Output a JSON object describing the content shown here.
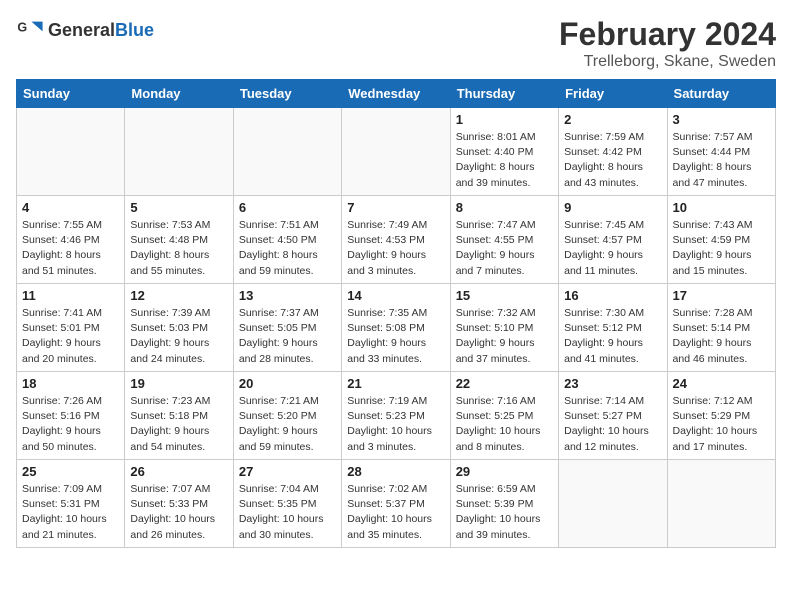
{
  "logo": {
    "general": "General",
    "blue": "Blue"
  },
  "header": {
    "month": "February 2024",
    "location": "Trelleborg, Skane, Sweden"
  },
  "weekdays": [
    "Sunday",
    "Monday",
    "Tuesday",
    "Wednesday",
    "Thursday",
    "Friday",
    "Saturday"
  ],
  "weeks": [
    [
      {
        "day": "",
        "sunrise": "",
        "sunset": "",
        "daylight": ""
      },
      {
        "day": "",
        "sunrise": "",
        "sunset": "",
        "daylight": ""
      },
      {
        "day": "",
        "sunrise": "",
        "sunset": "",
        "daylight": ""
      },
      {
        "day": "",
        "sunrise": "",
        "sunset": "",
        "daylight": ""
      },
      {
        "day": "1",
        "sunrise": "Sunrise: 8:01 AM",
        "sunset": "Sunset: 4:40 PM",
        "daylight": "Daylight: 8 hours and 39 minutes."
      },
      {
        "day": "2",
        "sunrise": "Sunrise: 7:59 AM",
        "sunset": "Sunset: 4:42 PM",
        "daylight": "Daylight: 8 hours and 43 minutes."
      },
      {
        "day": "3",
        "sunrise": "Sunrise: 7:57 AM",
        "sunset": "Sunset: 4:44 PM",
        "daylight": "Daylight: 8 hours and 47 minutes."
      }
    ],
    [
      {
        "day": "4",
        "sunrise": "Sunrise: 7:55 AM",
        "sunset": "Sunset: 4:46 PM",
        "daylight": "Daylight: 8 hours and 51 minutes."
      },
      {
        "day": "5",
        "sunrise": "Sunrise: 7:53 AM",
        "sunset": "Sunset: 4:48 PM",
        "daylight": "Daylight: 8 hours and 55 minutes."
      },
      {
        "day": "6",
        "sunrise": "Sunrise: 7:51 AM",
        "sunset": "Sunset: 4:50 PM",
        "daylight": "Daylight: 8 hours and 59 minutes."
      },
      {
        "day": "7",
        "sunrise": "Sunrise: 7:49 AM",
        "sunset": "Sunset: 4:53 PM",
        "daylight": "Daylight: 9 hours and 3 minutes."
      },
      {
        "day": "8",
        "sunrise": "Sunrise: 7:47 AM",
        "sunset": "Sunset: 4:55 PM",
        "daylight": "Daylight: 9 hours and 7 minutes."
      },
      {
        "day": "9",
        "sunrise": "Sunrise: 7:45 AM",
        "sunset": "Sunset: 4:57 PM",
        "daylight": "Daylight: 9 hours and 11 minutes."
      },
      {
        "day": "10",
        "sunrise": "Sunrise: 7:43 AM",
        "sunset": "Sunset: 4:59 PM",
        "daylight": "Daylight: 9 hours and 15 minutes."
      }
    ],
    [
      {
        "day": "11",
        "sunrise": "Sunrise: 7:41 AM",
        "sunset": "Sunset: 5:01 PM",
        "daylight": "Daylight: 9 hours and 20 minutes."
      },
      {
        "day": "12",
        "sunrise": "Sunrise: 7:39 AM",
        "sunset": "Sunset: 5:03 PM",
        "daylight": "Daylight: 9 hours and 24 minutes."
      },
      {
        "day": "13",
        "sunrise": "Sunrise: 7:37 AM",
        "sunset": "Sunset: 5:05 PM",
        "daylight": "Daylight: 9 hours and 28 minutes."
      },
      {
        "day": "14",
        "sunrise": "Sunrise: 7:35 AM",
        "sunset": "Sunset: 5:08 PM",
        "daylight": "Daylight: 9 hours and 33 minutes."
      },
      {
        "day": "15",
        "sunrise": "Sunrise: 7:32 AM",
        "sunset": "Sunset: 5:10 PM",
        "daylight": "Daylight: 9 hours and 37 minutes."
      },
      {
        "day": "16",
        "sunrise": "Sunrise: 7:30 AM",
        "sunset": "Sunset: 5:12 PM",
        "daylight": "Daylight: 9 hours and 41 minutes."
      },
      {
        "day": "17",
        "sunrise": "Sunrise: 7:28 AM",
        "sunset": "Sunset: 5:14 PM",
        "daylight": "Daylight: 9 hours and 46 minutes."
      }
    ],
    [
      {
        "day": "18",
        "sunrise": "Sunrise: 7:26 AM",
        "sunset": "Sunset: 5:16 PM",
        "daylight": "Daylight: 9 hours and 50 minutes."
      },
      {
        "day": "19",
        "sunrise": "Sunrise: 7:23 AM",
        "sunset": "Sunset: 5:18 PM",
        "daylight": "Daylight: 9 hours and 54 minutes."
      },
      {
        "day": "20",
        "sunrise": "Sunrise: 7:21 AM",
        "sunset": "Sunset: 5:20 PM",
        "daylight": "Daylight: 9 hours and 59 minutes."
      },
      {
        "day": "21",
        "sunrise": "Sunrise: 7:19 AM",
        "sunset": "Sunset: 5:23 PM",
        "daylight": "Daylight: 10 hours and 3 minutes."
      },
      {
        "day": "22",
        "sunrise": "Sunrise: 7:16 AM",
        "sunset": "Sunset: 5:25 PM",
        "daylight": "Daylight: 10 hours and 8 minutes."
      },
      {
        "day": "23",
        "sunrise": "Sunrise: 7:14 AM",
        "sunset": "Sunset: 5:27 PM",
        "daylight": "Daylight: 10 hours and 12 minutes."
      },
      {
        "day": "24",
        "sunrise": "Sunrise: 7:12 AM",
        "sunset": "Sunset: 5:29 PM",
        "daylight": "Daylight: 10 hours and 17 minutes."
      }
    ],
    [
      {
        "day": "25",
        "sunrise": "Sunrise: 7:09 AM",
        "sunset": "Sunset: 5:31 PM",
        "daylight": "Daylight: 10 hours and 21 minutes."
      },
      {
        "day": "26",
        "sunrise": "Sunrise: 7:07 AM",
        "sunset": "Sunset: 5:33 PM",
        "daylight": "Daylight: 10 hours and 26 minutes."
      },
      {
        "day": "27",
        "sunrise": "Sunrise: 7:04 AM",
        "sunset": "Sunset: 5:35 PM",
        "daylight": "Daylight: 10 hours and 30 minutes."
      },
      {
        "day": "28",
        "sunrise": "Sunrise: 7:02 AM",
        "sunset": "Sunset: 5:37 PM",
        "daylight": "Daylight: 10 hours and 35 minutes."
      },
      {
        "day": "29",
        "sunrise": "Sunrise: 6:59 AM",
        "sunset": "Sunset: 5:39 PM",
        "daylight": "Daylight: 10 hours and 39 minutes."
      },
      {
        "day": "",
        "sunrise": "",
        "sunset": "",
        "daylight": ""
      },
      {
        "day": "",
        "sunrise": "",
        "sunset": "",
        "daylight": ""
      }
    ]
  ]
}
